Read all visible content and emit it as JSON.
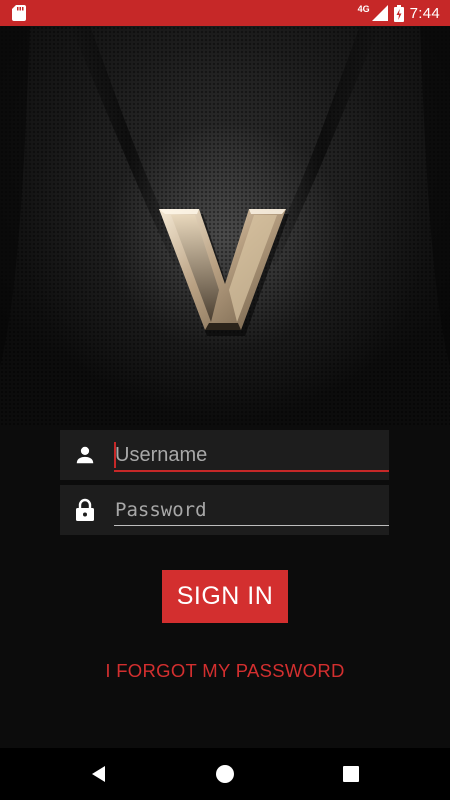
{
  "status_bar": {
    "time": "7:44",
    "network": "4G",
    "colors": {
      "background": "#c62828"
    },
    "icons": [
      "sd-card-icon",
      "signal-icon",
      "battery-charging-icon"
    ]
  },
  "logo": {
    "icon": "v-emblem-logo"
  },
  "login": {
    "username_placeholder": "Username",
    "username_value": "",
    "password_placeholder": "Password",
    "password_value": "",
    "username_icon": "user-icon",
    "password_icon": "lock-icon",
    "sign_in_label": "SIGN IN",
    "forgot_password_label": "I FORGOT MY PASSWORD"
  },
  "colors": {
    "accent": "#d32f2f",
    "background": "#0c0c0c",
    "field_background": "#1d1d1d"
  },
  "nav_bar": {
    "icons": [
      "back-icon",
      "home-icon",
      "recents-icon"
    ]
  }
}
